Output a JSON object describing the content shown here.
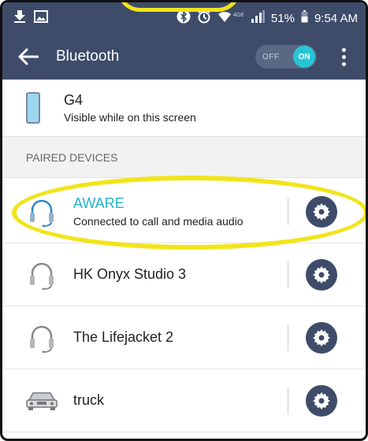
{
  "status_bar": {
    "battery": "51%",
    "time": "9:54 AM",
    "network": "4GE",
    "icons": [
      "download-icon",
      "image-icon",
      "bluetooth-icon",
      "alarm-icon",
      "wifi-icon",
      "signal-icon",
      "battery-icon"
    ]
  },
  "app_bar": {
    "title": "Bluetooth",
    "toggle_off_label": "OFF",
    "toggle_on_label": "ON",
    "toggle_state": "on"
  },
  "this_device": {
    "name": "G4",
    "subtitle": "Visible while on this screen"
  },
  "paired_header": "PAIRED DEVICES",
  "paired_devices": [
    {
      "name": "AWARE",
      "subtitle": "Connected to call and media audio",
      "icon": "headset-icon",
      "connected": true
    },
    {
      "name": "HK Onyx Studio 3",
      "icon": "headset-icon",
      "connected": false
    },
    {
      "name": "The Lifejacket 2",
      "icon": "headset-icon",
      "connected": false
    },
    {
      "name": "truck",
      "icon": "car-icon",
      "connected": false
    }
  ],
  "colors": {
    "bar": "#3e4c6a",
    "accent": "#27c6d6",
    "connected_text": "#21b3c8",
    "highlight": "#f2e41b"
  }
}
